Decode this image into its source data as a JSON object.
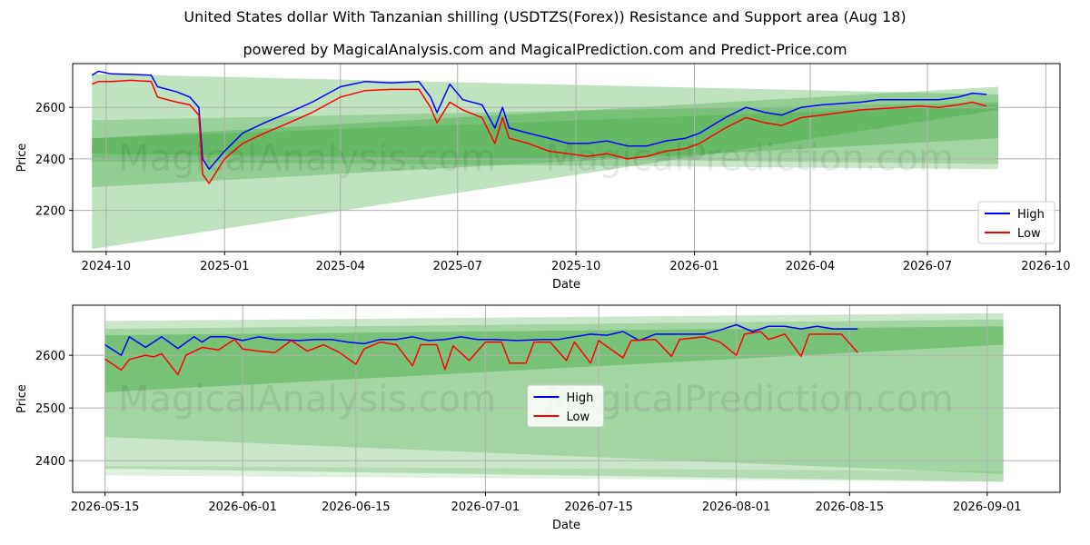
{
  "title": "United States dollar With Tanzanian shilling (USDTZS(Forex)) Resistance and Support area (Aug 18)",
  "subtitle": "powered by MagicalAnalysis.com and MagicalPrediction.com and Predict-Price.com",
  "watermark_left": "MagicalAnalysis.com",
  "watermark_right": "MagicalPrediction.com",
  "colors": {
    "high": "#0000ff",
    "low": "#ff0000",
    "band": "#2ca02c",
    "grid": "#b0b0b0"
  },
  "chart_data": [
    {
      "type": "line",
      "xlabel": "Date",
      "ylabel": "Price",
      "xlim": [
        "2024-09-05",
        "2026-10-12"
      ],
      "ylim": [
        2040,
        2770
      ],
      "x_ticks": [
        "2024-10",
        "2025-01",
        "2025-04",
        "2025-07",
        "2025-10",
        "2026-01",
        "2026-04",
        "2026-07",
        "2026-10"
      ],
      "y_ticks": [
        2200,
        2400,
        2600
      ],
      "grid": true,
      "legend": "bottom-right",
      "series": [
        {
          "name": "High",
          "color": "#0000ff",
          "points": [
            [
              "2024-09-20",
              2725
            ],
            [
              "2024-09-25",
              2740
            ],
            [
              "2024-10-05",
              2730
            ],
            [
              "2024-10-20",
              2728
            ],
            [
              "2024-11-05",
              2725
            ],
            [
              "2024-11-10",
              2680
            ],
            [
              "2024-11-25",
              2660
            ],
            [
              "2024-12-05",
              2640
            ],
            [
              "2024-12-12",
              2600
            ],
            [
              "2024-12-15",
              2400
            ],
            [
              "2024-12-20",
              2360
            ],
            [
              "2025-01-01",
              2430
            ],
            [
              "2025-01-15",
              2500
            ],
            [
              "2025-02-01",
              2540
            ],
            [
              "2025-02-20",
              2580
            ],
            [
              "2025-03-10",
              2620
            ],
            [
              "2025-04-01",
              2680
            ],
            [
              "2025-04-20",
              2700
            ],
            [
              "2025-05-10",
              2695
            ],
            [
              "2025-06-01",
              2700
            ],
            [
              "2025-06-10",
              2640
            ],
            [
              "2025-06-15",
              2580
            ],
            [
              "2025-06-25",
              2690
            ],
            [
              "2025-07-05",
              2630
            ],
            [
              "2025-07-20",
              2610
            ],
            [
              "2025-07-30",
              2520
            ],
            [
              "2025-08-05",
              2600
            ],
            [
              "2025-08-10",
              2520
            ],
            [
              "2025-08-25",
              2500
            ],
            [
              "2025-09-10",
              2480
            ],
            [
              "2025-09-25",
              2460
            ],
            [
              "2025-10-10",
              2460
            ],
            [
              "2025-10-25",
              2470
            ],
            [
              "2025-11-10",
              2450
            ],
            [
              "2025-11-25",
              2450
            ],
            [
              "2025-12-10",
              2470
            ],
            [
              "2025-12-25",
              2480
            ],
            [
              "2026-01-05",
              2500
            ],
            [
              "2026-01-25",
              2560
            ],
            [
              "2026-02-10",
              2600
            ],
            [
              "2026-02-25",
              2580
            ],
            [
              "2026-03-10",
              2570
            ],
            [
              "2026-03-25",
              2600
            ],
            [
              "2026-04-10",
              2610
            ],
            [
              "2026-04-25",
              2615
            ],
            [
              "2026-05-10",
              2620
            ],
            [
              "2026-05-25",
              2630
            ],
            [
              "2026-06-10",
              2630
            ],
            [
              "2026-06-25",
              2630
            ],
            [
              "2026-07-10",
              2630
            ],
            [
              "2026-07-25",
              2640
            ],
            [
              "2026-08-05",
              2655
            ],
            [
              "2026-08-16",
              2650
            ]
          ]
        },
        {
          "name": "Low",
          "color": "#ff0000",
          "points": [
            [
              "2024-09-20",
              2690
            ],
            [
              "2024-09-25",
              2700
            ],
            [
              "2024-10-05",
              2700
            ],
            [
              "2024-10-20",
              2705
            ],
            [
              "2024-11-05",
              2700
            ],
            [
              "2024-11-10",
              2640
            ],
            [
              "2024-11-25",
              2620
            ],
            [
              "2024-12-05",
              2610
            ],
            [
              "2024-12-12",
              2570
            ],
            [
              "2024-12-15",
              2340
            ],
            [
              "2024-12-20",
              2305
            ],
            [
              "2025-01-01",
              2400
            ],
            [
              "2025-01-15",
              2460
            ],
            [
              "2025-02-01",
              2500
            ],
            [
              "2025-02-20",
              2540
            ],
            [
              "2025-03-10",
              2580
            ],
            [
              "2025-04-01",
              2640
            ],
            [
              "2025-04-20",
              2665
            ],
            [
              "2025-05-10",
              2670
            ],
            [
              "2025-06-01",
              2670
            ],
            [
              "2025-06-10",
              2600
            ],
            [
              "2025-06-15",
              2540
            ],
            [
              "2025-06-25",
              2620
            ],
            [
              "2025-07-05",
              2590
            ],
            [
              "2025-07-20",
              2560
            ],
            [
              "2025-07-30",
              2460
            ],
            [
              "2025-08-05",
              2560
            ],
            [
              "2025-08-10",
              2480
            ],
            [
              "2025-08-25",
              2460
            ],
            [
              "2025-09-10",
              2430
            ],
            [
              "2025-09-25",
              2420
            ],
            [
              "2025-10-10",
              2410
            ],
            [
              "2025-10-25",
              2420
            ],
            [
              "2025-11-10",
              2400
            ],
            [
              "2025-11-25",
              2410
            ],
            [
              "2025-12-10",
              2430
            ],
            [
              "2025-12-25",
              2440
            ],
            [
              "2026-01-05",
              2460
            ],
            [
              "2026-01-25",
              2520
            ],
            [
              "2026-02-10",
              2560
            ],
            [
              "2026-02-25",
              2540
            ],
            [
              "2026-03-10",
              2530
            ],
            [
              "2026-03-25",
              2560
            ],
            [
              "2026-04-10",
              2570
            ],
            [
              "2026-04-25",
              2580
            ],
            [
              "2026-05-10",
              2590
            ],
            [
              "2026-05-25",
              2595
            ],
            [
              "2026-06-10",
              2600
            ],
            [
              "2026-06-25",
              2605
            ],
            [
              "2026-07-10",
              2600
            ],
            [
              "2026-07-25",
              2610
            ],
            [
              "2026-08-05",
              2620
            ],
            [
              "2026-08-16",
              2605
            ]
          ]
        }
      ],
      "bands": [
        {
          "start": "2024-09-20",
          "end": "2026-08-25",
          "low": [
            2050,
            2590
          ],
          "high": [
            2730,
            2650
          ],
          "opacity": 0.3
        },
        {
          "start": "2024-09-20",
          "end": "2026-08-25",
          "low": [
            2290,
            2480
          ],
          "high": [
            2480,
            2680
          ],
          "opacity": 0.3
        },
        {
          "start": "2024-09-20",
          "end": "2026-08-25",
          "low": [
            2390,
            2360
          ],
          "high": [
            2550,
            2620
          ],
          "opacity": 0.25
        },
        {
          "start": "2024-09-20",
          "end": "2026-08-25",
          "low": [
            2420,
            2380
          ],
          "high": [
            2480,
            2610
          ],
          "opacity": 0.25
        }
      ]
    },
    {
      "type": "line",
      "xlabel": "Date",
      "ylabel": "Price",
      "xlim": [
        "2026-05-11",
        "2026-09-10"
      ],
      "ylim": [
        2340,
        2695
      ],
      "x_ticks": [
        "2026-05-15",
        "2026-06-01",
        "2026-06-15",
        "2026-07-01",
        "2026-07-15",
        "2026-08-01",
        "2026-08-15",
        "2026-09-01"
      ],
      "y_ticks": [
        2400,
        2500,
        2600
      ],
      "grid": true,
      "legend": "center",
      "series": [
        {
          "name": "High",
          "color": "#0000ff",
          "points": [
            [
              "2026-05-15",
              2620
            ],
            [
              "2026-05-17",
              2600
            ],
            [
              "2026-05-18",
              2635
            ],
            [
              "2026-05-20",
              2615
            ],
            [
              "2026-05-22",
              2635
            ],
            [
              "2026-05-24",
              2613
            ],
            [
              "2026-05-26",
              2635
            ],
            [
              "2026-05-27",
              2625
            ],
            [
              "2026-05-28",
              2635
            ],
            [
              "2026-05-30",
              2635
            ],
            [
              "2026-06-01",
              2628
            ],
            [
              "2026-06-03",
              2635
            ],
            [
              "2026-06-05",
              2630
            ],
            [
              "2026-06-08",
              2628
            ],
            [
              "2026-06-10",
              2630
            ],
            [
              "2026-06-12",
              2630
            ],
            [
              "2026-06-14",
              2625
            ],
            [
              "2026-06-16",
              2622
            ],
            [
              "2026-06-18",
              2630
            ],
            [
              "2026-06-20",
              2630
            ],
            [
              "2026-06-22",
              2635
            ],
            [
              "2026-06-24",
              2628
            ],
            [
              "2026-06-26",
              2630
            ],
            [
              "2026-06-28",
              2635
            ],
            [
              "2026-06-30",
              2630
            ],
            [
              "2026-07-02",
              2630
            ],
            [
              "2026-07-05",
              2628
            ],
            [
              "2026-07-08",
              2630
            ],
            [
              "2026-07-10",
              2630
            ],
            [
              "2026-07-12",
              2635
            ],
            [
              "2026-07-14",
              2640
            ],
            [
              "2026-07-16",
              2638
            ],
            [
              "2026-07-18",
              2645
            ],
            [
              "2026-07-20",
              2628
            ],
            [
              "2026-07-22",
              2640
            ],
            [
              "2026-07-25",
              2640
            ],
            [
              "2026-07-28",
              2640
            ],
            [
              "2026-07-30",
              2648
            ],
            [
              "2026-08-01",
              2658
            ],
            [
              "2026-08-03",
              2645
            ],
            [
              "2026-08-05",
              2655
            ],
            [
              "2026-08-07",
              2655
            ],
            [
              "2026-08-09",
              2650
            ],
            [
              "2026-08-11",
              2655
            ],
            [
              "2026-08-13",
              2650
            ],
            [
              "2026-08-16",
              2650
            ]
          ]
        },
        {
          "name": "Low",
          "color": "#ff0000",
          "points": [
            [
              "2026-05-15",
              2593
            ],
            [
              "2026-05-17",
              2572
            ],
            [
              "2026-05-18",
              2592
            ],
            [
              "2026-05-20",
              2600
            ],
            [
              "2026-05-21",
              2597
            ],
            [
              "2026-05-22",
              2603
            ],
            [
              "2026-05-24",
              2563
            ],
            [
              "2026-05-25",
              2600
            ],
            [
              "2026-05-27",
              2615
            ],
            [
              "2026-05-29",
              2610
            ],
            [
              "2026-05-31",
              2630
            ],
            [
              "2026-06-01",
              2612
            ],
            [
              "2026-06-03",
              2608
            ],
            [
              "2026-06-05",
              2605
            ],
            [
              "2026-06-07",
              2628
            ],
            [
              "2026-06-09",
              2608
            ],
            [
              "2026-06-11",
              2620
            ],
            [
              "2026-06-13",
              2605
            ],
            [
              "2026-06-15",
              2583
            ],
            [
              "2026-06-16",
              2612
            ],
            [
              "2026-06-18",
              2625
            ],
            [
              "2026-06-20",
              2620
            ],
            [
              "2026-06-22",
              2580
            ],
            [
              "2026-06-23",
              2620
            ],
            [
              "2026-06-25",
              2620
            ],
            [
              "2026-06-26",
              2573
            ],
            [
              "2026-06-27",
              2618
            ],
            [
              "2026-06-29",
              2590
            ],
            [
              "2026-07-01",
              2625
            ],
            [
              "2026-07-03",
              2625
            ],
            [
              "2026-07-04",
              2585
            ],
            [
              "2026-07-06",
              2585
            ],
            [
              "2026-07-07",
              2625
            ],
            [
              "2026-07-09",
              2625
            ],
            [
              "2026-07-11",
              2590
            ],
            [
              "2026-07-12",
              2625
            ],
            [
              "2026-07-14",
              2585
            ],
            [
              "2026-07-15",
              2628
            ],
            [
              "2026-07-18",
              2595
            ],
            [
              "2026-07-19",
              2628
            ],
            [
              "2026-07-22",
              2630
            ],
            [
              "2026-07-24",
              2598
            ],
            [
              "2026-07-25",
              2630
            ],
            [
              "2026-07-28",
              2635
            ],
            [
              "2026-07-30",
              2625
            ],
            [
              "2026-08-01",
              2600
            ],
            [
              "2026-08-02",
              2640
            ],
            [
              "2026-08-04",
              2645
            ],
            [
              "2026-08-05",
              2630
            ],
            [
              "2026-08-07",
              2640
            ],
            [
              "2026-08-09",
              2598
            ],
            [
              "2026-08-10",
              2640
            ],
            [
              "2026-08-12",
              2640
            ],
            [
              "2026-08-14",
              2640
            ],
            [
              "2026-08-16",
              2605
            ]
          ]
        }
      ],
      "bands": [
        {
          "start": "2026-05-15",
          "end": "2026-09-03",
          "low": [
            2385,
            2360
          ],
          "high": [
            2665,
            2680
          ],
          "opacity": 0.25
        },
        {
          "start": "2026-05-15",
          "end": "2026-09-03",
          "low": [
            2445,
            2375
          ],
          "high": [
            2650,
            2668
          ],
          "opacity": 0.25
        },
        {
          "start": "2026-05-15",
          "end": "2026-09-03",
          "low": [
            2530,
            2620
          ],
          "high": [
            2638,
            2655
          ],
          "opacity": 0.35
        },
        {
          "start": "2026-05-15",
          "end": "2026-09-03",
          "low": [
            2372,
            2360
          ],
          "high": [
            2390,
            2380
          ],
          "opacity": 0.15
        }
      ]
    }
  ]
}
